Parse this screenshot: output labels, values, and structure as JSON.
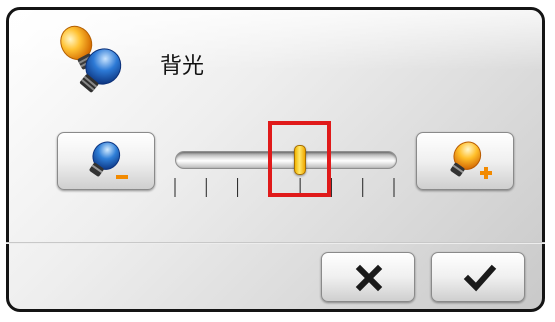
{
  "dialog": {
    "title": "背光",
    "title_icon": "lightbulbs-icon"
  },
  "brightness": {
    "decrease_icon": "blue-bulb-minus-icon",
    "increase_icon": "yellow-bulb-plus-icon",
    "level_fraction": 0.5,
    "tick_count": 8
  },
  "actions": {
    "cancel_icon": "close-x-icon",
    "ok_icon": "checkmark-icon"
  },
  "colors": {
    "highlight": "#e01a1a",
    "thumb": "#f2b400"
  }
}
